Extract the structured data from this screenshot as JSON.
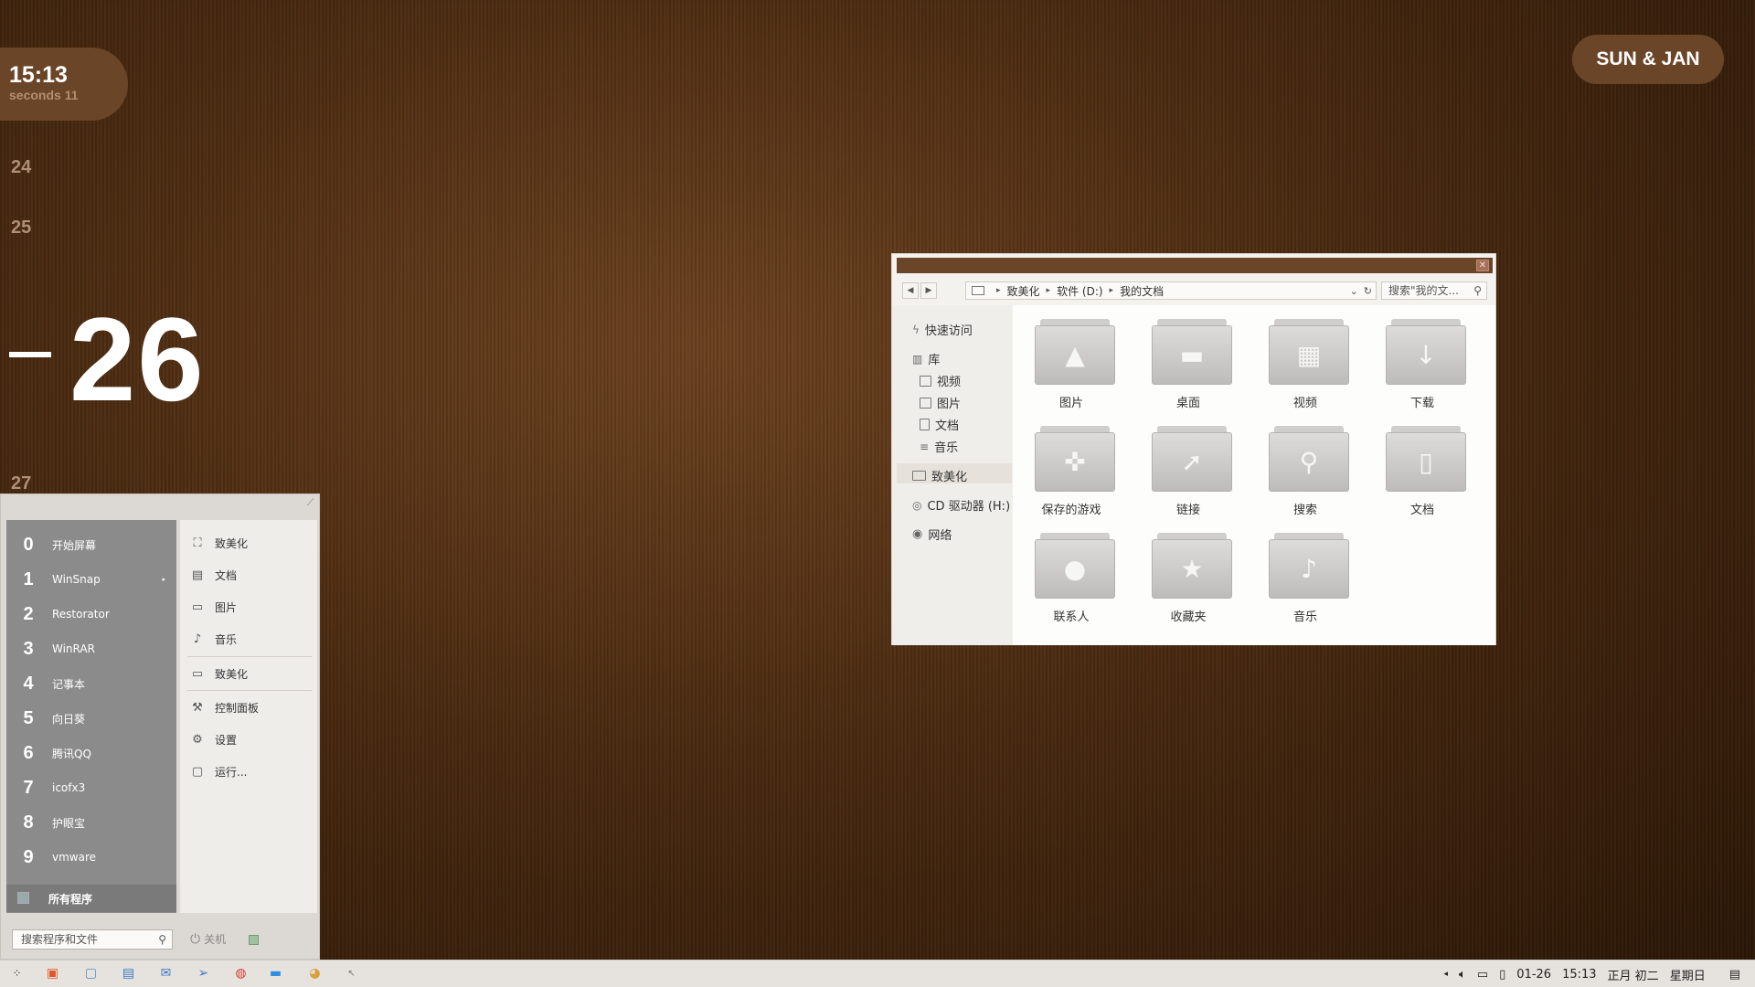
{
  "clock": {
    "time": "15:13",
    "seconds": "seconds 11"
  },
  "date_pill": "SUN & JAN",
  "calendar": {
    "d24": "24",
    "d25": "25",
    "d26": "26",
    "d27": "27"
  },
  "explorer": {
    "close": "✕",
    "breadcrumb": [
      "致美化",
      "软件 (D:)",
      "我的文档"
    ],
    "search_placeholder": "搜索\"我的文...",
    "sidebar": {
      "quick": "快速访问",
      "lib": "库",
      "videos": "视频",
      "pictures": "图片",
      "docs": "文档",
      "music": "音乐",
      "pc": "致美化",
      "cd": "CD 驱动器 (H:)",
      "net": "网络"
    },
    "folders": [
      {
        "label": "图片",
        "glyph": "▲"
      },
      {
        "label": "桌面",
        "glyph": "▬"
      },
      {
        "label": "视频",
        "glyph": "▦"
      },
      {
        "label": "下载",
        "glyph": "↓"
      },
      {
        "label": "保存的游戏",
        "glyph": "✜"
      },
      {
        "label": "链接",
        "glyph": "➚"
      },
      {
        "label": "搜索",
        "glyph": "⚲"
      },
      {
        "label": "文档",
        "glyph": "▯"
      },
      {
        "label": "联系人",
        "glyph": "●"
      },
      {
        "label": "收藏夹",
        "glyph": "★"
      },
      {
        "label": "音乐",
        "glyph": "♪"
      }
    ]
  },
  "start_menu": {
    "pinned": [
      {
        "num": "0",
        "label": "开始屏幕"
      },
      {
        "num": "1",
        "label": "WinSnap"
      },
      {
        "num": "2",
        "label": "Restorator"
      },
      {
        "num": "3",
        "label": "WinRAR"
      },
      {
        "num": "4",
        "label": "记事本"
      },
      {
        "num": "5",
        "label": "向日葵"
      },
      {
        "num": "6",
        "label": "腾讯QQ"
      },
      {
        "num": "7",
        "label": "icofx3"
      },
      {
        "num": "8",
        "label": "护眼宝"
      },
      {
        "num": "9",
        "label": "vmware"
      }
    ],
    "all_programs": "所有程序",
    "right": {
      "user": "致美化",
      "docs": "文档",
      "pics": "图片",
      "music": "音乐",
      "pc": "致美化",
      "control": "控制面板",
      "settings": "设置",
      "run": "运行..."
    },
    "search_placeholder": "搜索程序和文件",
    "shutdown": "关机"
  },
  "taskbar": {
    "date": "01-26",
    "time": "15:13",
    "lunar": "正月 初二",
    "weekday": "星期日"
  }
}
